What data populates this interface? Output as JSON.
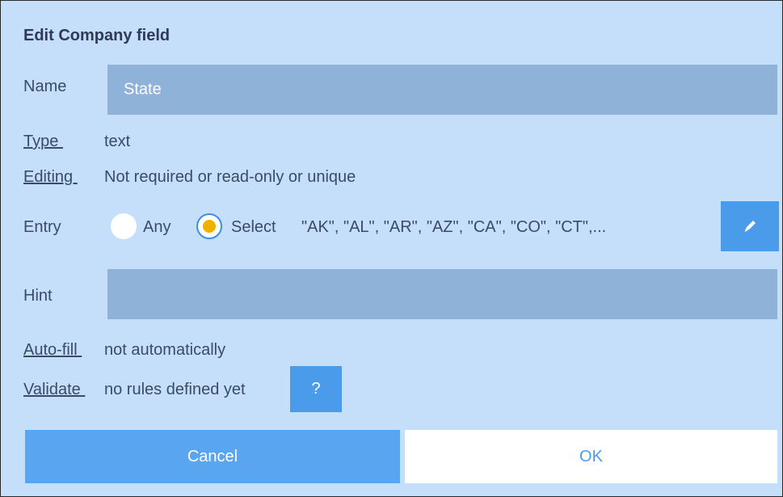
{
  "dialog": {
    "title": "Edit Company field"
  },
  "name_row": {
    "label": "Name",
    "value": "State"
  },
  "type_row": {
    "label": "Type ",
    "value": "text"
  },
  "editing_row": {
    "label": "Editing ",
    "value": "Not required or read-only or unique"
  },
  "entry_row": {
    "label": "Entry",
    "option_any": "Any",
    "option_select": "Select",
    "selected_option": "Select",
    "select_values": "\"AK\", \"AL\", \"AR\", \"AZ\", \"CA\", \"CO\", \"CT\",...",
    "edit_icon": "pencil-icon"
  },
  "hint_row": {
    "label": "Hint",
    "value": ""
  },
  "autofill_row": {
    "label": "Auto-fill ",
    "value": "not automatically"
  },
  "validate_row": {
    "label": "Validate ",
    "value": "no rules defined yet",
    "help_label": "?"
  },
  "buttons": {
    "cancel": "Cancel",
    "ok": "OK"
  },
  "colors": {
    "background": "#c5dffb",
    "field": "#8fb3d8",
    "accent": "#4a9bea",
    "radio_selected": "#f0b000"
  }
}
